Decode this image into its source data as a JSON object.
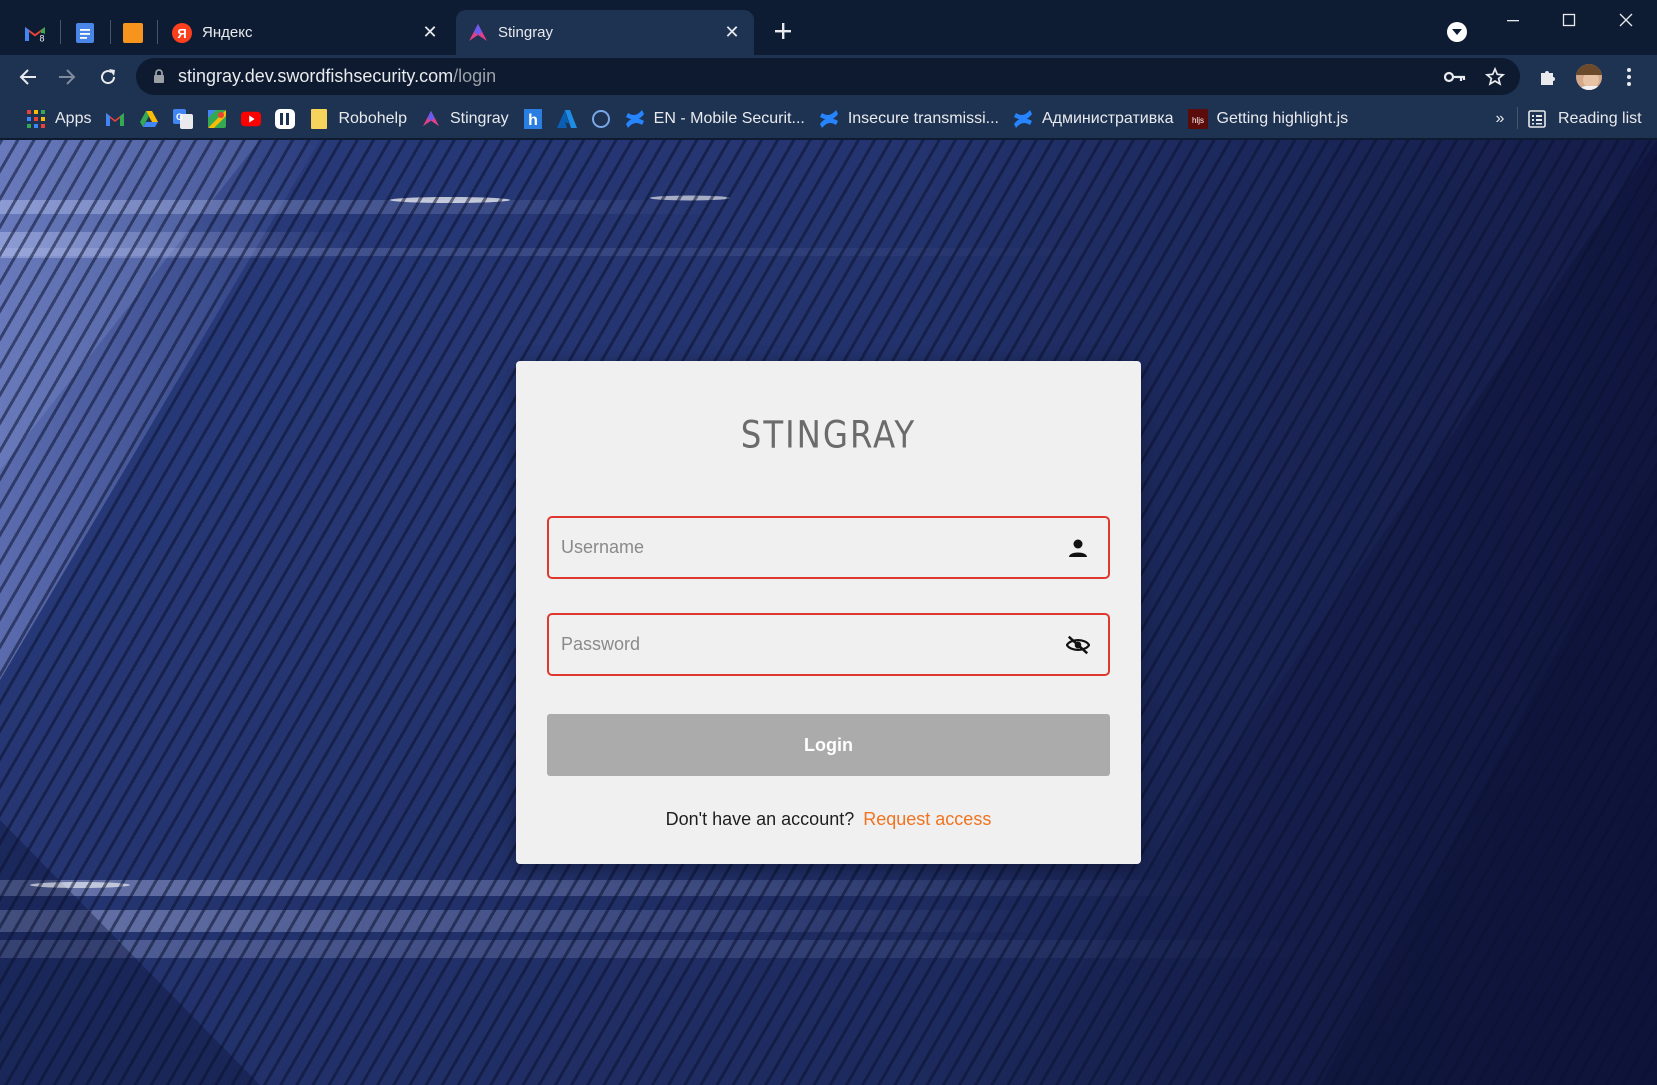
{
  "browser": {
    "pinned_tabs": [
      {
        "icon": "gmail-icon",
        "badge": "8"
      },
      {
        "icon": "docs-icon"
      },
      {
        "icon": "orange-square-icon"
      }
    ],
    "tabs": [
      {
        "title": "Яндекс",
        "icon": "yandex-icon",
        "active": false
      },
      {
        "title": "Stingray",
        "icon": "stingray-icon",
        "active": true
      }
    ],
    "url": {
      "host": "stingray.dev.swordfishsecurity.com",
      "path": "/login"
    },
    "bookmarks": [
      {
        "label": "Apps",
        "icon": "apps-grid-icon"
      },
      {
        "label": "",
        "icon": "gmail-icon"
      },
      {
        "label": "",
        "icon": "google-drive-icon"
      },
      {
        "label": "",
        "icon": "google-translate-icon"
      },
      {
        "label": "",
        "icon": "google-maps-icon"
      },
      {
        "label": "",
        "icon": "youtube-icon"
      },
      {
        "label": "",
        "icon": "pause-app-icon"
      },
      {
        "label": "Robohelp",
        "icon": "folder-icon"
      },
      {
        "label": "Stingray",
        "icon": "stingray-icon"
      },
      {
        "label": "",
        "icon": "h-logo-icon"
      },
      {
        "label": "",
        "icon": "azure-icon"
      },
      {
        "label": "",
        "icon": "circle-icon"
      },
      {
        "label": "EN - Mobile Securit...",
        "icon": "confluence-icon"
      },
      {
        "label": "Insecure transmissi...",
        "icon": "confluence-icon"
      },
      {
        "label": "Административка",
        "icon": "confluence-icon"
      },
      {
        "label": "Getting highlight.js",
        "icon": "hljs-icon"
      }
    ],
    "bookmarks_overflow": "»",
    "reading_list": "Reading list",
    "colors": {
      "frame": "#0e1c33",
      "toolbar": "#1e3252",
      "omnibox": "#0d1a30"
    }
  },
  "login": {
    "brand": "STINGRAY",
    "username_placeholder": "Username",
    "password_placeholder": "Password",
    "login_label": "Login",
    "signup_prompt": "Don't have an account?",
    "signup_link": "Request access",
    "colors": {
      "error_border": "#e0382e",
      "link": "#f07320",
      "button_disabled": "#ababab"
    }
  }
}
